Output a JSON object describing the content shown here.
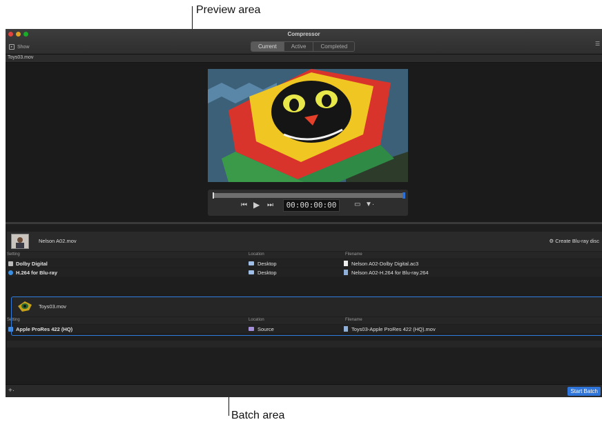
{
  "callouts": {
    "preview": "Preview area",
    "batch": "Batch area"
  },
  "window": {
    "title": "Compressor",
    "show_label": "Show",
    "tabs": [
      {
        "label": "Current",
        "active": true
      },
      {
        "label": "Active",
        "active": false
      },
      {
        "label": "Completed",
        "active": false
      }
    ]
  },
  "preview": {
    "file_label": "Toys03.mov",
    "timecode": "00:00:00:00"
  },
  "batch": {
    "columns": {
      "setting": "Setting",
      "location": "Location",
      "filename": "Filename"
    },
    "jobs": [
      {
        "name": "Nelson A02.mov",
        "action": "Create Blu-ray disc",
        "rows": [
          {
            "setting": "Dolby Digital",
            "location": "Desktop",
            "filename": "Nelson A02-Dolby Digital.ac3"
          },
          {
            "setting": "H.264 for Blu-ray",
            "location": "Desktop",
            "filename": "Nelson A02-H.264 for Blu-ray.264"
          }
        ]
      },
      {
        "name": "Toys03.mov",
        "rows": [
          {
            "setting": "Apple ProRes 422 (HQ)",
            "location": "Source",
            "filename": "Toys03-Apple ProRes 422 (HQ).mov"
          }
        ]
      }
    ],
    "start_label": "Start Batch"
  },
  "colors": {
    "accent": "#2f74d8",
    "selection_border": "#2f7fe0",
    "window_bg": "#1e1e1e"
  }
}
